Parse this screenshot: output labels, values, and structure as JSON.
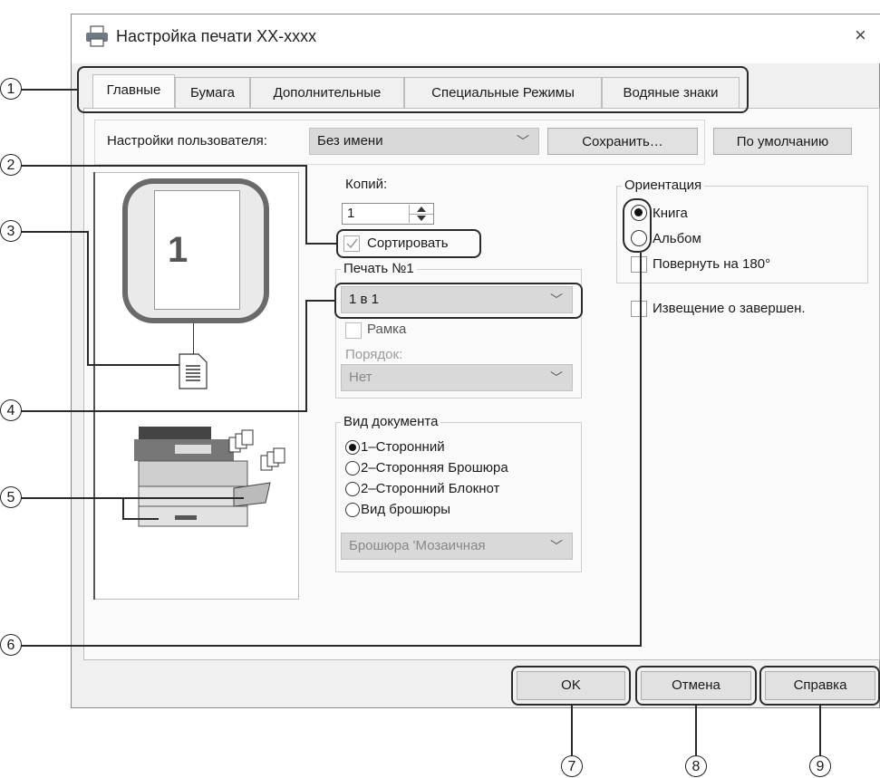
{
  "window": {
    "title": "Настройка печати XX-xxxx",
    "close_glyph": "×"
  },
  "tabs": [
    "Главные",
    "Бумага",
    "Дополнительные",
    "Специальные Режимы",
    "Водяные знаки"
  ],
  "user_settings": {
    "label": "Настройки пользователя:",
    "value": "Без имени",
    "save_label": "Сохранить…",
    "default_label": "По умолчанию"
  },
  "preview": {
    "page_number": "1"
  },
  "copies": {
    "label": "Копий:",
    "value": "1"
  },
  "collate": {
    "label": "Сортировать",
    "checked": true
  },
  "n_up": {
    "group_title": "Печать №1",
    "value": "1 в 1",
    "border_label": "Рамка",
    "order_label": "Порядок:",
    "order_value": "Нет"
  },
  "document_style": {
    "group_title": "Вид документа",
    "options": [
      "1–Сторонний",
      "2–Сторонняя Брошюра",
      "2–Сторонний Блокнот",
      "Вид брошюры"
    ],
    "selected_index": 0,
    "booklet_value": "Брошюра 'Мозаичная"
  },
  "orientation": {
    "group_title": "Ориентация",
    "options": [
      "Книга",
      "Альбом"
    ],
    "selected_index": 0,
    "rotate_label": "Повернуть на 180°"
  },
  "job_end_notice": {
    "label": "Извещение о завершен."
  },
  "buttons": {
    "ok": "OK",
    "cancel": "Отмена",
    "help": "Справка"
  },
  "callouts": [
    "1",
    "2",
    "3",
    "4",
    "5",
    "6",
    "7",
    "8",
    "9"
  ],
  "colors": {
    "window_bg": "#f0f0f0",
    "panel_bg": "#fafafa",
    "dropdown_bg": "#d9d9d9",
    "callout": "#2b2b2b"
  }
}
